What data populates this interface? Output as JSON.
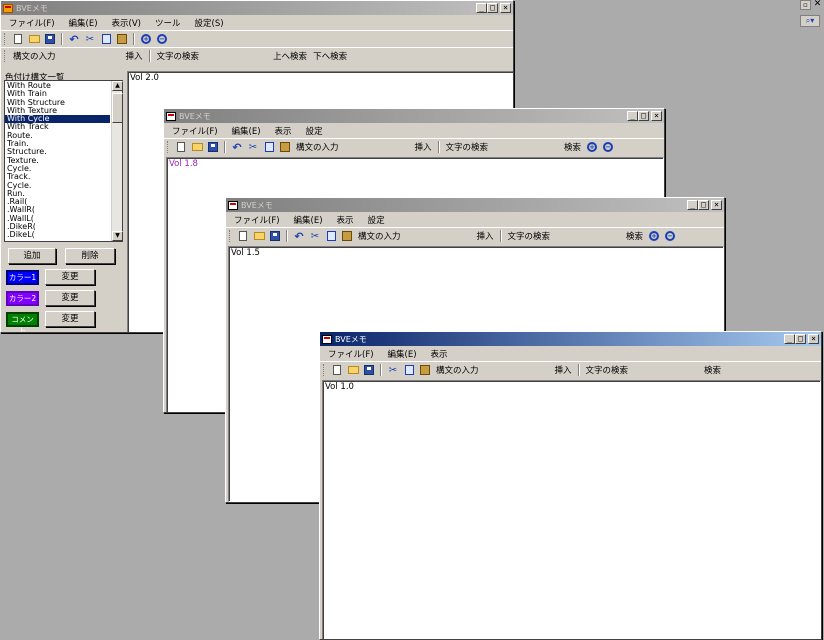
{
  "corner": {
    "restore_icon": "restore-icon",
    "close_icon": "close-icon",
    "search_icon": "search-icon"
  },
  "main_window": {
    "title": "BVEメモ",
    "menu": [
      "ファイル(F)",
      "編集(E)",
      "表示(V)",
      "ツール",
      "設定(S)"
    ],
    "syntax_label": "構文の入力",
    "insert_label": "挿入",
    "search_label": "文字の検索",
    "search_up": "上へ検索",
    "search_down": "下へ検索",
    "list_title": "色付け構文一覧",
    "list_items": [
      "With Route",
      "With Train",
      "With Structure",
      "With Texture",
      "With Cycle",
      "With Track",
      "Route.",
      "Train.",
      "Structure.",
      "Texture.",
      "Cycle.",
      "Track.",
      "Cycle.",
      "Run.",
      ".Rail(",
      ".WallR(",
      ".WallL(",
      ".DikeR(",
      ".DikeL("
    ],
    "selected_item": "With Cycle",
    "add_button": "追加",
    "delete_button": "削除",
    "color1_label": "カラー1",
    "color2_label": "カラー2",
    "comment_label": "コメント",
    "change_button": "変更",
    "editor_text": "Vol 2.0",
    "colors": {
      "color1": "#0000ff",
      "color2": "#8000ff",
      "comment": "#008000"
    }
  },
  "win18": {
    "title": "BVEメモ",
    "menu": [
      "ファイル(F)",
      "編集(E)",
      "表示",
      "設定"
    ],
    "syntax_label": "構文の入力",
    "insert_label": "挿入",
    "search_label": "文字の検索",
    "search_button": "検索",
    "editor_text": "Vol 1.8",
    "editor_color": "#a020c0"
  },
  "win15": {
    "title": "BVEメモ",
    "menu": [
      "ファイル(F)",
      "編集(E)",
      "表示",
      "設定"
    ],
    "syntax_label": "構文の入力",
    "insert_label": "挿入",
    "search_label": "文字の検索",
    "search_button": "検索",
    "editor_text": "Vol 1.5"
  },
  "win10": {
    "title": "BVEメモ",
    "menu": [
      "ファイル(F)",
      "編集(E)",
      "表示"
    ],
    "syntax_label": "構文の入力",
    "insert_label": "挿入",
    "search_label": "文字の検索",
    "search_button": "検索",
    "editor_text": "Vol 1.0"
  }
}
